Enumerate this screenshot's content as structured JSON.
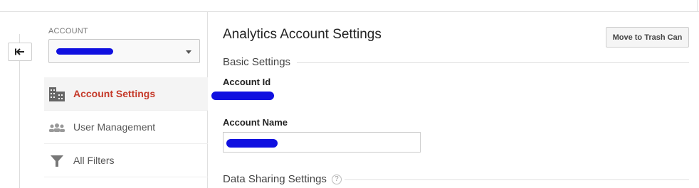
{
  "back_button": {
    "icon": "back-arrow-icon",
    "glyph": "↤"
  },
  "sidebar": {
    "account_label": "ACCOUNT",
    "account_selector": {
      "value": ""
    },
    "items": [
      {
        "label": "Account Settings",
        "icon": "building-icon",
        "active": true
      },
      {
        "label": "User Management",
        "icon": "users-icon",
        "active": false
      },
      {
        "label": "All Filters",
        "icon": "filter-icon",
        "active": false
      }
    ]
  },
  "main": {
    "title": "Analytics Account Settings",
    "trash_button_label": "Move to Trash Can",
    "basic_settings": {
      "heading": "Basic Settings",
      "account_id_label": "Account Id",
      "account_id_value": "",
      "account_name_label": "Account Name",
      "account_name_value": ""
    },
    "data_sharing": {
      "heading": "Data Sharing Settings",
      "help_glyph": "?"
    }
  },
  "colors": {
    "accent_active": "#c53929",
    "redaction": "#1010e0",
    "icon_gray": "#666666"
  }
}
